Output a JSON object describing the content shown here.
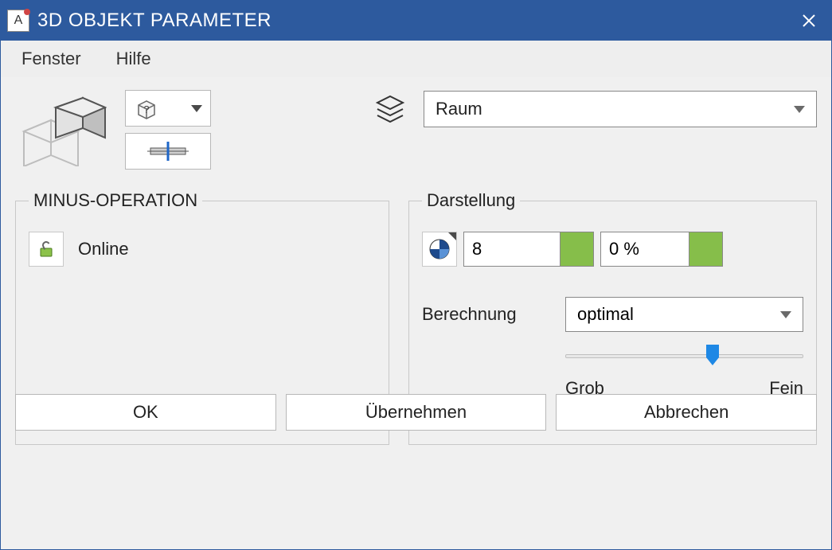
{
  "title": "3D OBJEKT PARAMETER",
  "app_icon_letter": "A",
  "menu": {
    "fenster": "Fenster",
    "hilfe": "Hilfe"
  },
  "layer": {
    "value": "Raum"
  },
  "minus_op": {
    "legend": "MINUS-OPERATION",
    "online": "Online"
  },
  "darstellung": {
    "legend": "Darstellung",
    "value1": "8",
    "value2": "0 %",
    "berechnung_label": "Berechnung",
    "berechnung_value": "optimal",
    "slider_min": "Grob",
    "slider_max": "Fein",
    "slider_pos_percent": 62
  },
  "footer": {
    "ok": "OK",
    "apply": "Übernehmen",
    "cancel": "Abbrechen"
  },
  "colors": {
    "swatch": "#86be4a",
    "titlebar": "#2d5a9e",
    "thumb": "#1e88e5"
  }
}
